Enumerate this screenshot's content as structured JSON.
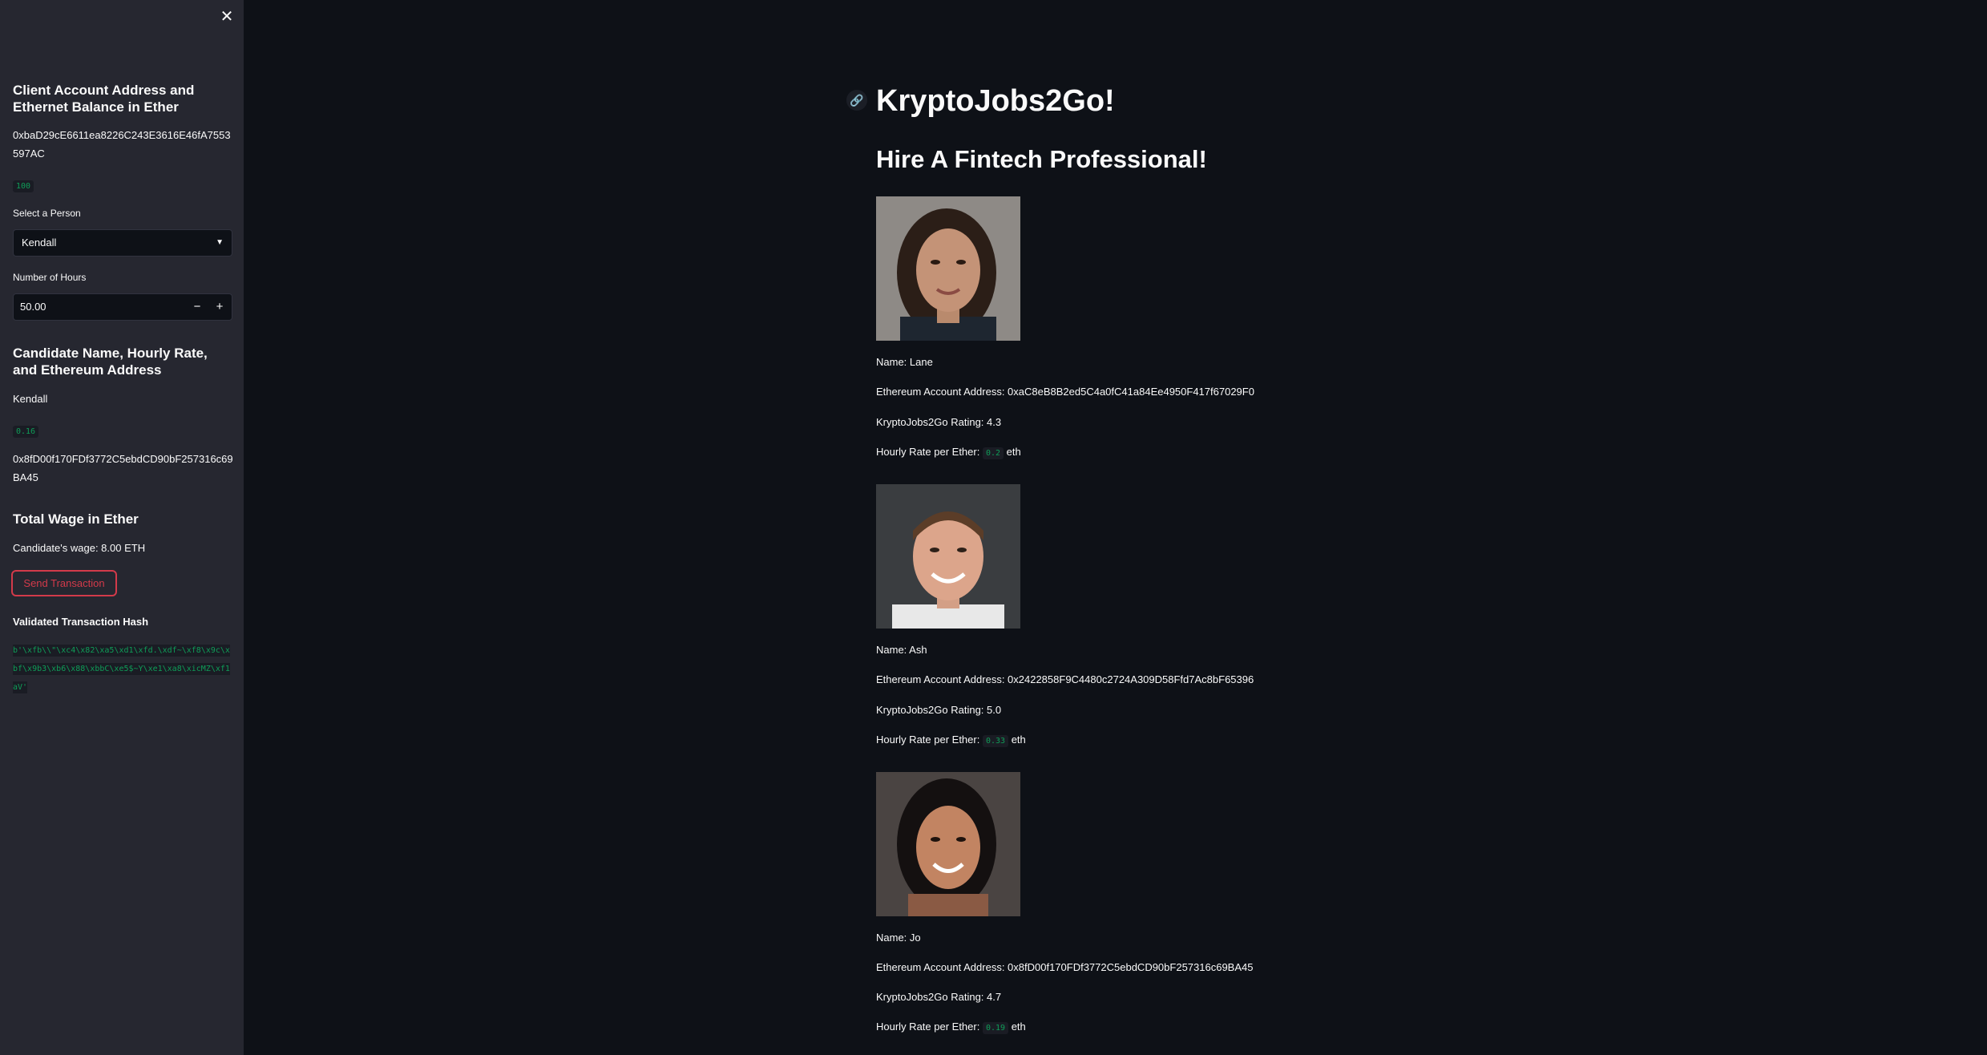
{
  "sidebar": {
    "close_icon": "close-icon",
    "account_header": "Client Account Address and Ethernet Balance in Ether",
    "account_address": "0xbaD29cE6611ea8226C243E3616E46fA7553597AC",
    "balance": "100",
    "select_label": "Select a Person",
    "selected_person": "Kendall",
    "hours_label": "Number of Hours",
    "hours_value": "50.00",
    "minus": "−",
    "plus": "+",
    "candidate_header": "Candidate Name, Hourly Rate, and Ethereum Address",
    "candidate_name": "Kendall",
    "candidate_rate": "0.16",
    "candidate_address": "0x8fD00f170FDf3772C5ebdCD90bF257316c69BA45",
    "wage_header": "Total Wage in Ether",
    "wage_text": "Candidate's wage: 8.00 ETH",
    "send_button": "Send Transaction",
    "hash_header": "Validated Transaction Hash",
    "hash_value": "b'\\xfb\\\\\"\\xc4\\x82\\xa5\\xd1\\xfd.\\xdf~\\xf8\\x9c\\xbf\\x9b3\\xb6\\x88\\xbbC\\xe5$~Y\\xe1\\xa8\\xicMZ\\xf1aV'"
  },
  "main": {
    "link_icon": "link-icon",
    "title": "KryptoJobs2Go!",
    "subtitle": "Hire A Fintech Professional!",
    "candidates": [
      {
        "name": "Name: Lane",
        "address": "Ethereum Account Address: 0xaC8eB8B2ed5C4a0fC41a84Ee4950F417f67029F0",
        "rating": "KryptoJobs2Go Rating: 4.3",
        "rate_prefix": "Hourly Rate per Ether:",
        "rate": "0.2",
        "rate_suffix": "eth"
      },
      {
        "name": "Name: Ash",
        "address": "Ethereum Account Address: 0x2422858F9C4480c2724A309D58Ffd7Ac8bF65396",
        "rating": "KryptoJobs2Go Rating: 5.0",
        "rate_prefix": "Hourly Rate per Ether:",
        "rate": "0.33",
        "rate_suffix": "eth"
      },
      {
        "name": "Name: Jo",
        "address": "Ethereum Account Address: 0x8fD00f170FDf3772C5ebdCD90bF257316c69BA45",
        "rating": "KryptoJobs2Go Rating: 4.7",
        "rate_prefix": "Hourly Rate per Ether:",
        "rate": "0.19",
        "rate_suffix": "eth"
      }
    ]
  }
}
